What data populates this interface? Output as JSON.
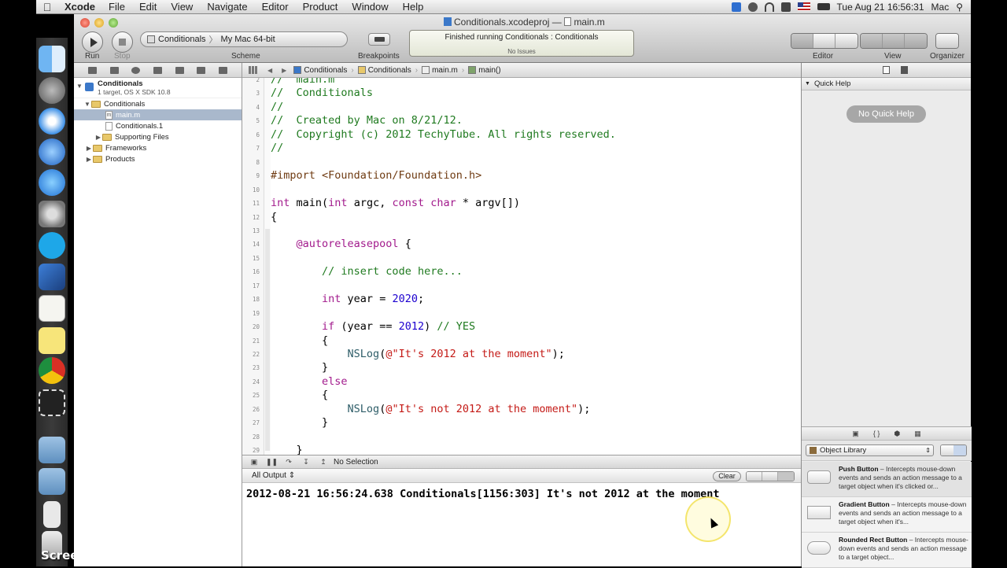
{
  "menubar": {
    "app": "Xcode",
    "items": [
      "File",
      "Edit",
      "View",
      "Navigate",
      "Editor",
      "Product",
      "Window",
      "Help"
    ],
    "clock": "Tue Aug 21  16:56:31",
    "user": "Mac"
  },
  "dock": {
    "apps": [
      "finder-icon",
      "rocket-icon",
      "safari-icon",
      "itunes-icon",
      "appstore-icon",
      "system-preferences-icon",
      "skype-icon",
      "xcode-icon",
      "textedit-icon",
      "stickies-icon",
      "chrome-icon",
      "screencapture-icon",
      "applications-folder-icon",
      "documents-folder-icon",
      "video-file-icon",
      "trash-icon"
    ],
    "recorder_label": "Screencast-O-Matic.com"
  },
  "window": {
    "title_file": "Conditionals.xcodeproj",
    "title_sep": "—",
    "title_doc": "main.m"
  },
  "toolbar": {
    "run_label": "Run",
    "stop_label": "Stop",
    "scheme_name": "Conditionals",
    "scheme_sep": "〉",
    "scheme_dest": "My Mac 64-bit",
    "scheme_label": "Scheme",
    "breakpoints_label": "Breakpoints",
    "activity_status": "Finished running Conditionals : Conditionals",
    "activity_issues": "No Issues",
    "editor_label": "Editor",
    "view_label": "View",
    "organizer_label": "Organizer"
  },
  "navigator": {
    "project_name": "Conditionals",
    "project_sub": "1 target, OS X SDK 10.8",
    "items": [
      {
        "label": "Conditionals",
        "kind": "folder",
        "level": 1,
        "open": true
      },
      {
        "label": "main.m",
        "kind": "file",
        "level": 2,
        "selected": true
      },
      {
        "label": "Conditionals.1",
        "kind": "file",
        "level": 2
      },
      {
        "label": "Supporting Files",
        "kind": "folder",
        "level": 2
      },
      {
        "label": "Frameworks",
        "kind": "folder",
        "level": 1
      },
      {
        "label": "Products",
        "kind": "folder",
        "level": 1
      }
    ]
  },
  "jumpbar": {
    "crumbs": [
      "Conditionals",
      "Conditionals",
      "main.m",
      "main()"
    ]
  },
  "code": {
    "lines": [
      {
        "n": "2",
        "text": "//  main.m"
      },
      {
        "n": "3",
        "text": "//  Conditionals"
      },
      {
        "n": "4",
        "text": "//"
      },
      {
        "n": "5",
        "text": "//  Created by Mac on 8/21/12."
      },
      {
        "n": "6",
        "text": "//  Copyright (c) 2012 TechyTube. All rights reserved."
      },
      {
        "n": "7",
        "text": "//"
      },
      {
        "n": "8",
        "text": ""
      },
      {
        "n": "9",
        "text": "#import <Foundation/Foundation.h>"
      },
      {
        "n": "10",
        "text": ""
      },
      {
        "n": "11",
        "text": "int main(int argc, const char * argv[])"
      },
      {
        "n": "12",
        "text": "{"
      },
      {
        "n": "13",
        "text": ""
      },
      {
        "n": "14",
        "text": "    @autoreleasepool {"
      },
      {
        "n": "15",
        "text": ""
      },
      {
        "n": "16",
        "text": "        // insert code here..."
      },
      {
        "n": "17",
        "text": ""
      },
      {
        "n": "18",
        "text": "        int year = 2020;"
      },
      {
        "n": "19",
        "text": ""
      },
      {
        "n": "20",
        "text": "        if (year == 2012) // YES"
      },
      {
        "n": "21",
        "text": "        {"
      },
      {
        "n": "22",
        "text": "            NSLog(@\"It's 2012 at the moment\");"
      },
      {
        "n": "23",
        "text": "        }"
      },
      {
        "n": "24",
        "text": "        else"
      },
      {
        "n": "25",
        "text": "        {"
      },
      {
        "n": "26",
        "text": "            NSLog(@\"It's not 2012 at the moment\");"
      },
      {
        "n": "27",
        "text": "        }"
      },
      {
        "n": "28",
        "text": ""
      },
      {
        "n": "29",
        "text": "    }"
      }
    ]
  },
  "debug": {
    "selection": "No Selection",
    "output_filter": "All Output",
    "clear_label": "Clear",
    "console_line": "2012-08-21 16:56:24.638 Conditionals[1156:303] It's not 2012 at the moment"
  },
  "utilities": {
    "quick_help_title": "Quick Help",
    "no_quick_help": "No Quick Help",
    "library_select": "Object Library",
    "library_items": [
      {
        "name": "Push Button",
        "desc": " – Intercepts mouse-down events and sends an action message to a target object when it's clicked or..."
      },
      {
        "name": "Gradient Button",
        "desc": " – Intercepts mouse-down events and sends an action message to a target object when it's..."
      },
      {
        "name": "Rounded Rect Button",
        "desc": " – Intercepts mouse-down events and sends an action message to a target object..."
      }
    ]
  },
  "colors": {
    "comment": "#1f7a1f",
    "keyword": "#a21a8c",
    "string": "#c41a16",
    "number": "#1c00cf",
    "preprocessor": "#6f3b12",
    "selection": "#a9b8cc"
  }
}
